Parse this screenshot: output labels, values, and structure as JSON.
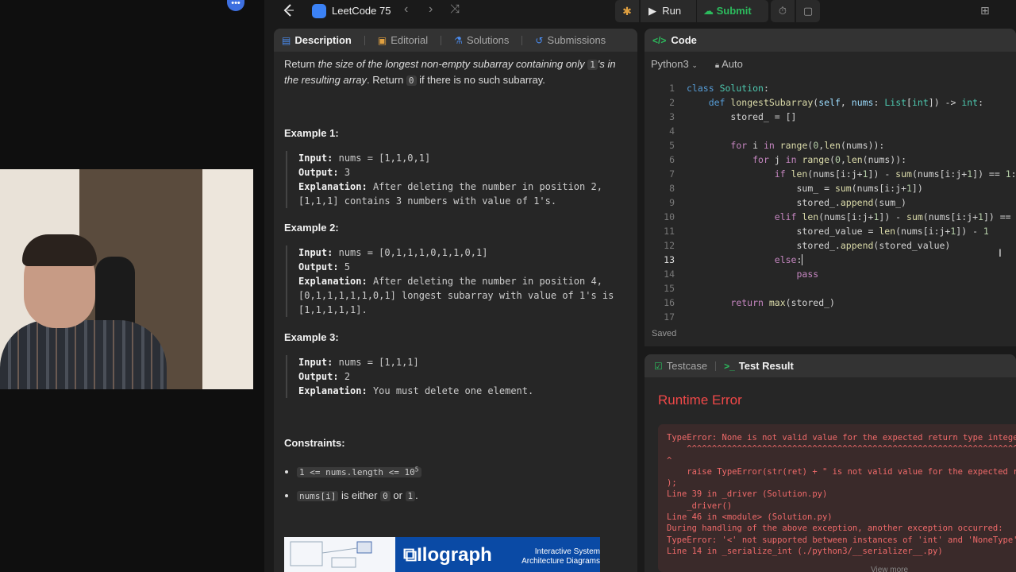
{
  "top_nav": {
    "list_title": "LeetCode 75",
    "run_label": "Run",
    "submit_label": "Submit"
  },
  "desc_panel": {
    "tabs": [
      {
        "label": "Description",
        "icon": "document-icon"
      },
      {
        "label": "Editorial",
        "icon": "book-icon"
      },
      {
        "label": "Solutions",
        "icon": "flask-icon"
      },
      {
        "label": "Submissions",
        "icon": "history-icon"
      }
    ],
    "intro_plain1": "Return ",
    "intro_em1": "the size of the longest non-empty subarray containing only ",
    "intro_code1": "1",
    "intro_em2": "'s in the resulting array",
    "intro_plain2": ". Return ",
    "intro_code2": "0",
    "intro_plain3": " if there is no such subarray.",
    "examples": [
      {
        "title": "Example 1:",
        "input_label": "Input:",
        "input": "nums = [1,1,0,1]",
        "output_label": "Output:",
        "output": "3",
        "expl_label": "Explanation:",
        "expl": "After deleting the number in position 2, [1,1,1] contains 3 numbers with value of 1's."
      },
      {
        "title": "Example 2:",
        "input_label": "Input:",
        "input": "nums = [0,1,1,1,0,1,1,0,1]",
        "output_label": "Output:",
        "output": "5",
        "expl_label": "Explanation:",
        "expl": "After deleting the number in position 4, [0,1,1,1,1,1,0,1] longest subarray with value of 1's is [1,1,1,1,1]."
      },
      {
        "title": "Example 3:",
        "input_label": "Input:",
        "input": "nums = [1,1,1]",
        "output_label": "Output:",
        "output": "2",
        "expl_label": "Explanation:",
        "expl": "You must delete one element."
      }
    ],
    "constraints_title": "Constraints:",
    "constraint1_code": "1 <= nums.length <= 10",
    "constraint1_sup": "5",
    "constraint2_code": "nums[i]",
    "constraint2_mid": " is either ",
    "constraint2_a": "0",
    "constraint2_or": " or ",
    "constraint2_b": "1",
    "constraint2_end": ".",
    "ad_logo": "Ilograph",
    "ad_tag": "Interactive System Architecture Diagrams"
  },
  "code_panel": {
    "title": "Code",
    "language": "Python3",
    "mode": "Auto",
    "saved": "Saved",
    "current_line": 13
  },
  "result_panel": {
    "tabs": [
      {
        "label": "Testcase",
        "icon": "checkbox-icon"
      },
      {
        "label": "Test Result",
        "icon": "terminal-icon"
      }
    ],
    "title": "Runtime Error",
    "error_text": "TypeError: None is not valid value for the expected return type integer\n    ^^^^^^^^^^^^^^^^^^^^^^^^^^^^^^^^^^^^^^^^^^^^^^^^^^^^^^^^^^^^^^^^^^^^^^^^^^^\n^\n    raise TypeError(str(ret) + \" is not valid value for the expected return type\n);\nLine 39 in _driver (Solution.py)\n    _driver()\nLine 46 in <module> (Solution.py)\nDuring handling of the above exception, another exception occurred:\nTypeError: '<' not supported between instances of 'int' and 'NoneType'\nLine 14 in _serialize_int (./python3/__serializer__.py)",
    "view_more": "View more"
  },
  "colors": {
    "accent_green": "#2cbb5d",
    "error_red": "#f04848",
    "tab_blue": "#4a8cf0"
  }
}
